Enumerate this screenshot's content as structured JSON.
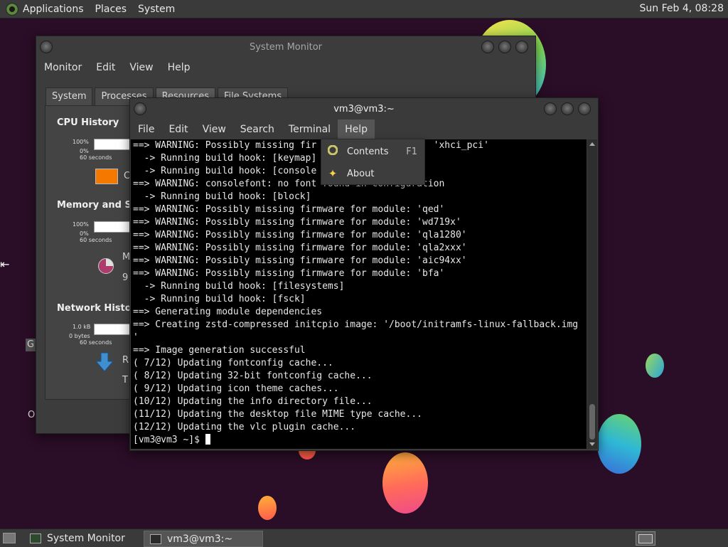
{
  "top_panel": {
    "menus": [
      "Applications",
      "Places",
      "System"
    ],
    "clock": "Sun Feb  4, 08:28"
  },
  "system_monitor": {
    "title": "System Monitor",
    "menu": [
      "Monitor",
      "Edit",
      "View",
      "Help"
    ],
    "tabs": [
      "System",
      "Processes",
      "Resources",
      "File Systems"
    ],
    "active_tab": "Resources",
    "cpu": {
      "title": "CPU History",
      "top_label": "100%",
      "bottom_label": "0%",
      "time_label": "60 seconds",
      "legend_char": "C",
      "legend_color": "#f57900"
    },
    "memory": {
      "title": "Memory and Swa",
      "top_label": "100%",
      "bottom_label": "0%",
      "time_label": "60 seconds",
      "label_partial": "M",
      "value_partial": "9",
      "pie_color": "#ad3b6b"
    },
    "network": {
      "title": "Network History",
      "top_label": "1.0 kB",
      "bottom_label": "0 bytes",
      "time_label": "60 seconds",
      "recv_partial": "R",
      "total_partial": "T",
      "arrow_color": "#3f8fd0"
    }
  },
  "terminal": {
    "title": "vm3@vm3:~",
    "menu": [
      "File",
      "Edit",
      "View",
      "Search",
      "Terminal",
      "Help"
    ],
    "lines": [
      "==> WARNING: Possibly missing fir                     'xhci_pci'",
      "  -> Running build hook: [keymap]",
      "  -> Running build hook: [console",
      "==> WARNING: consolefont: no font found in configuration",
      "  -> Running build hook: [block]",
      "==> WARNING: Possibly missing firmware for module: 'qed'",
      "==> WARNING: Possibly missing firmware for module: 'wd719x'",
      "==> WARNING: Possibly missing firmware for module: 'qla1280'",
      "==> WARNING: Possibly missing firmware for module: 'qla2xxx'",
      "==> WARNING: Possibly missing firmware for module: 'aic94xx'",
      "==> WARNING: Possibly missing firmware for module: 'bfa'",
      "  -> Running build hook: [filesystems]",
      "  -> Running build hook: [fsck]",
      "==> Generating module dependencies",
      "==> Creating zstd-compressed initcpio image: '/boot/initramfs-linux-fallback.img",
      "'",
      "==> Image generation successful",
      "( 7/12) Updating fontconfig cache...",
      "( 8/12) Updating 32-bit fontconfig cache...",
      "( 9/12) Updating icon theme caches...",
      "(10/12) Updating the info directory file...",
      "(11/12) Updating the desktop file MIME type cache...",
      "(12/12) Updating the vlc plugin cache..."
    ],
    "prompt": "[vm3@vm3 ~]$ "
  },
  "help_menu": {
    "items": [
      {
        "label": "Contents",
        "accel": "F1",
        "icon": "help-contents-icon"
      },
      {
        "label": "About",
        "accel": "",
        "icon": "about-star-icon"
      }
    ]
  },
  "desktop_fragments": {
    "left_g": "G",
    "left_o": "O"
  },
  "bottom_panel": {
    "tasks": [
      "System Monitor",
      "vm3@vm3:~"
    ],
    "active_task": "vm3@vm3:~"
  }
}
